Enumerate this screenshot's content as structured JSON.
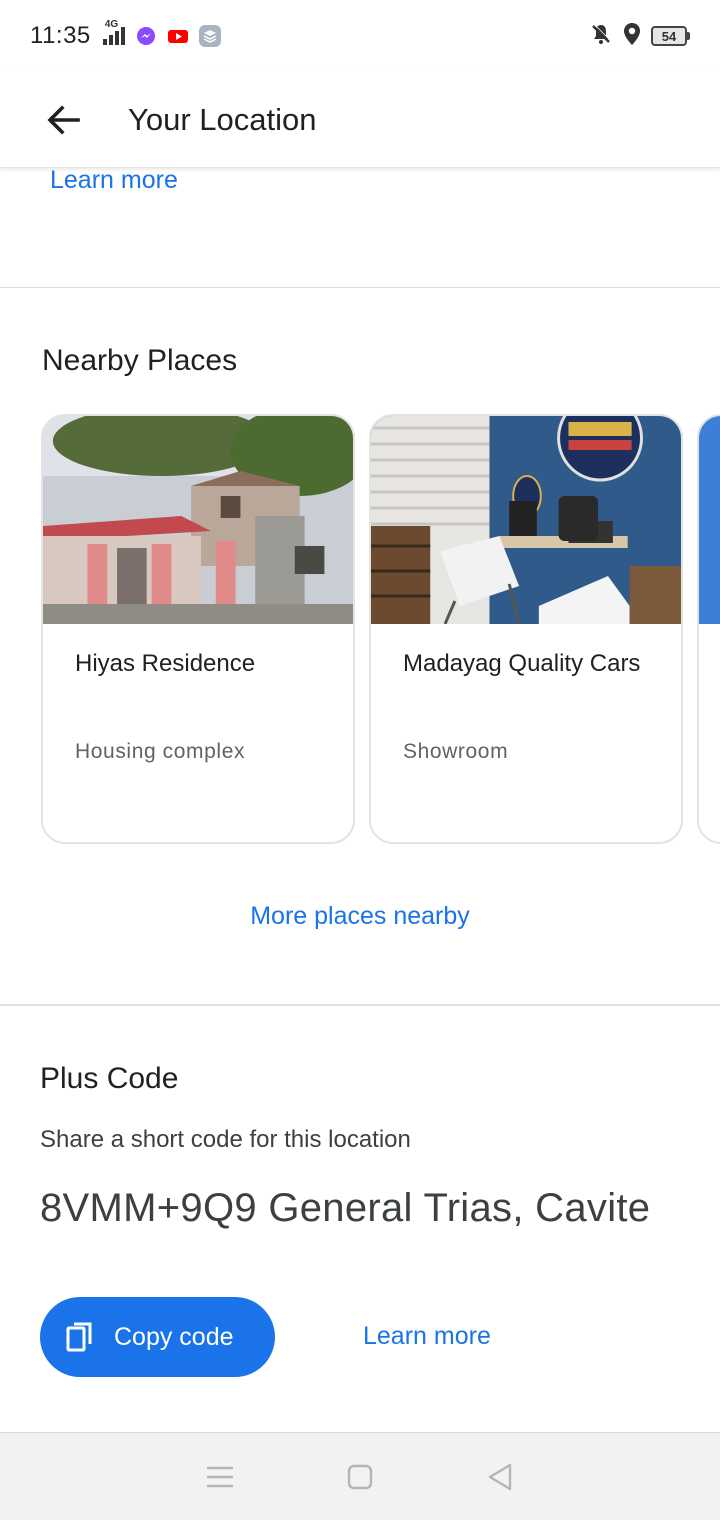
{
  "status_bar": {
    "time": "11:35",
    "network": "4G",
    "battery": "54"
  },
  "header": {
    "title": "Your Location"
  },
  "top_section": {
    "learn_more": "Learn more"
  },
  "nearby": {
    "title": "Nearby Places",
    "places": [
      {
        "name": "Hiyas Residence",
        "type": "Housing complex"
      },
      {
        "name": "Madayag Quality Cars",
        "type": "Showroom"
      }
    ],
    "more_link": "More places nearby"
  },
  "plus_code": {
    "title": "Plus Code",
    "description": "Share a short code for this location",
    "code": "8VMM+9Q9 General Trias, Cavite",
    "copy_label": "Copy code",
    "learn_more": "Learn more"
  },
  "colors": {
    "accent": "#1a73e8",
    "text_primary": "#202124",
    "text_secondary": "#5f6368"
  }
}
